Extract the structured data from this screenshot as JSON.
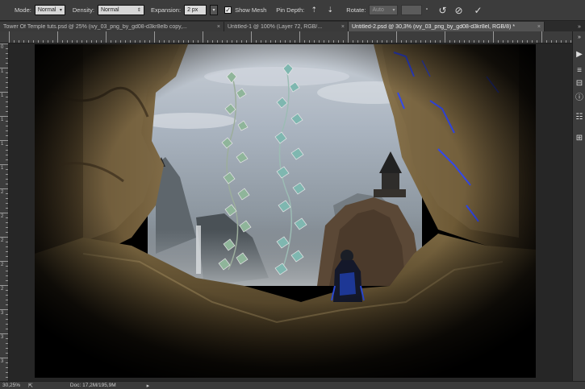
{
  "options_bar": {
    "mode_label": "Mode:",
    "mode_value": "Normal",
    "density_label": "Density:",
    "density_value": "Normal",
    "expansion_label": "Expansion:",
    "expansion_value": "2 px",
    "show_mesh_label": "Show Mesh",
    "show_mesh_checked": true,
    "pin_depth_label": "Pin Depth:",
    "rotate_label": "Rotate:",
    "rotate_value": "Auto"
  },
  "tabs": [
    {
      "label": "Tower Of Temple tuts.psd @ 25% (ivy_03_png_by_gd08-d3kr8elb copy,...",
      "active": false
    },
    {
      "label": "Untitled-1 @ 100% (Layer 72, RGB/...",
      "active": false
    },
    {
      "label": "Untitled-2.psd @ 30,3% (ivy_03_png_by_gd08-d3kr8el, RGB/8) *",
      "active": true
    }
  ],
  "ruler_v_numbers": [
    "0",
    "1",
    "1",
    "1",
    "1",
    "1",
    "2",
    "2",
    "2",
    "2",
    "2",
    "3",
    "3",
    "3"
  ],
  "status": {
    "zoom": "30,25%",
    "doc": "Doc: 17,2M/195,9M"
  },
  "icons": {
    "tool_options": "liquify-tool-icon",
    "pin_depth_stepper": "pin-depth-stepper-icon",
    "undo": "undo-icon",
    "cancel": "cancel-icon",
    "commit": "commit-checkmark-icon"
  }
}
